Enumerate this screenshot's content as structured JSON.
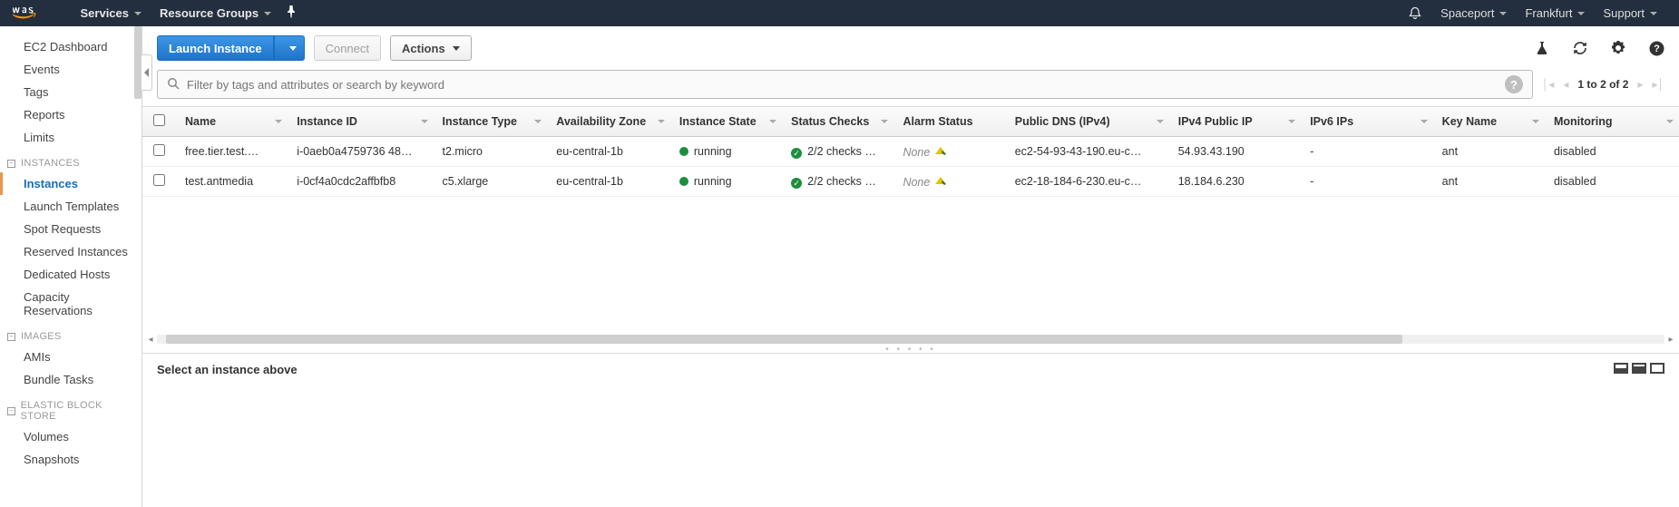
{
  "nav": {
    "services": "Services",
    "resource_groups": "Resource Groups",
    "account": "Spaceport",
    "region": "Frankfurt",
    "support": "Support"
  },
  "sidebar": {
    "top": [
      "EC2 Dashboard",
      "Events",
      "Tags",
      "Reports",
      "Limits"
    ],
    "sections": [
      {
        "title": "INSTANCES",
        "items": [
          "Instances",
          "Launch Templates",
          "Spot Requests",
          "Reserved Instances",
          "Dedicated Hosts",
          "Capacity Reservations"
        ],
        "active": "Instances"
      },
      {
        "title": "IMAGES",
        "items": [
          "AMIs",
          "Bundle Tasks"
        ]
      },
      {
        "title": "ELASTIC BLOCK STORE",
        "items": [
          "Volumes",
          "Snapshots"
        ]
      }
    ]
  },
  "toolbar": {
    "launch": "Launch Instance",
    "connect": "Connect",
    "actions": "Actions"
  },
  "filter": {
    "placeholder": "Filter by tags and attributes or search by keyword",
    "help": "?"
  },
  "pager": {
    "text": "1 to 2 of 2"
  },
  "table": {
    "columns": [
      "Name",
      "Instance ID",
      "Instance Type",
      "Availability Zone",
      "Instance State",
      "Status Checks",
      "Alarm Status",
      "Public DNS (IPv4)",
      "IPv4 Public IP",
      "IPv6 IPs",
      "Key Name",
      "Monitoring"
    ],
    "rows": [
      {
        "name": "free.tier.test.…",
        "instance_id": "i-0aeb0a4759736 48…",
        "instance_type": "t2.micro",
        "az": "eu-central-1b",
        "state": "running",
        "status": "2/2 checks …",
        "alarm": "None",
        "dns": "ec2-54-93-43-190.eu-c…",
        "ip4": "54.93.43.190",
        "ip6": "-",
        "key": "ant",
        "monitoring": "disabled"
      },
      {
        "name": "test.antmedia",
        "instance_id": "i-0cf4a0cdc2affbfb8",
        "instance_type": "c5.xlarge",
        "az": "eu-central-1b",
        "state": "running",
        "status": "2/2 checks …",
        "alarm": "None",
        "dns": "ec2-18-184-6-230.eu-c…",
        "ip4": "18.184.6.230",
        "ip6": "-",
        "key": "ant",
        "monitoring": "disabled"
      }
    ]
  },
  "detail": {
    "message": "Select an instance above"
  }
}
